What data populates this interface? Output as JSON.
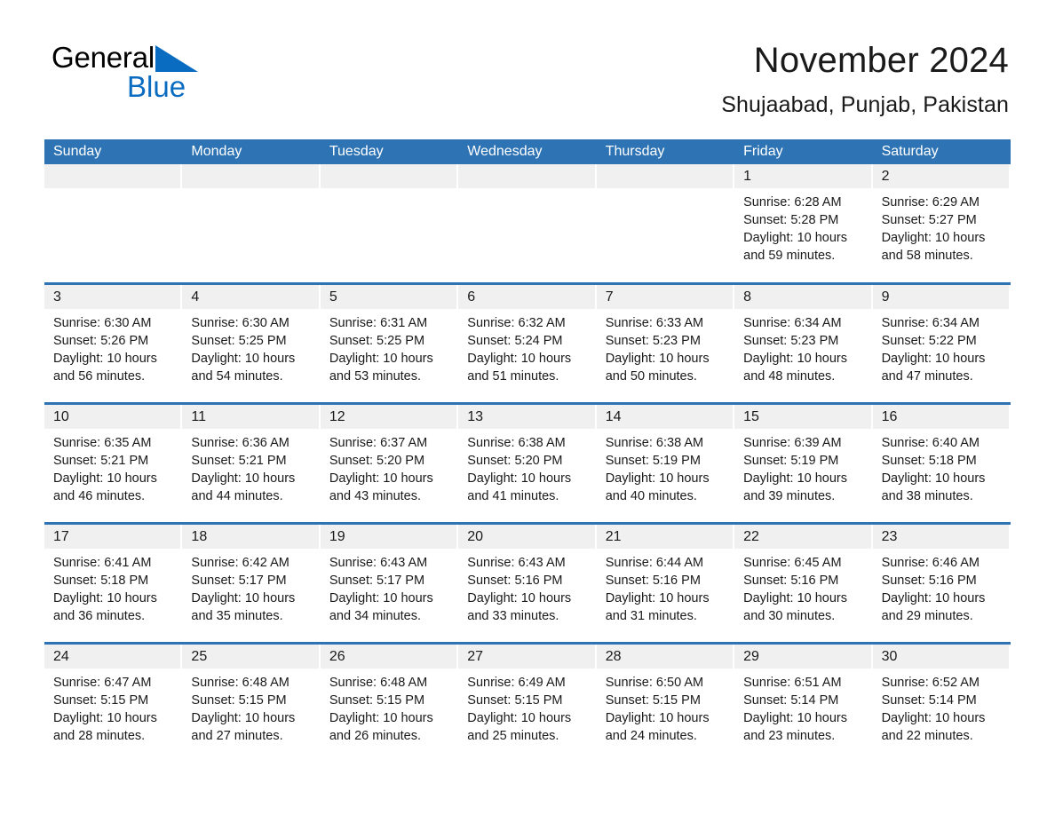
{
  "logo": {
    "word1": "General",
    "word2": "Blue",
    "triangle_color": "#0a6cc0",
    "icon": "triangle-icon"
  },
  "header": {
    "title": "November 2024",
    "subtitle": "Shujaabad, Punjab, Pakistan"
  },
  "colors": {
    "header_blue": "#2e74b5",
    "daynum_band": "#f0f0f0",
    "text": "#1a1a1a",
    "logo_blue": "#0a6cc0"
  },
  "weekdays": [
    "Sunday",
    "Monday",
    "Tuesday",
    "Wednesday",
    "Thursday",
    "Friday",
    "Saturday"
  ],
  "labels": {
    "sunrise_prefix": "Sunrise: ",
    "sunset_prefix": "Sunset: ",
    "daylight_prefix": "Daylight: "
  },
  "weeks": [
    [
      {
        "empty": true
      },
      {
        "empty": true
      },
      {
        "empty": true
      },
      {
        "empty": true
      },
      {
        "empty": true
      },
      {
        "day": "1",
        "sunrise": "Sunrise: 6:28 AM",
        "sunset": "Sunset: 5:28 PM",
        "daylight1": "Daylight: 10 hours",
        "daylight2": "and 59 minutes."
      },
      {
        "day": "2",
        "sunrise": "Sunrise: 6:29 AM",
        "sunset": "Sunset: 5:27 PM",
        "daylight1": "Daylight: 10 hours",
        "daylight2": "and 58 minutes."
      }
    ],
    [
      {
        "day": "3",
        "sunrise": "Sunrise: 6:30 AM",
        "sunset": "Sunset: 5:26 PM",
        "daylight1": "Daylight: 10 hours",
        "daylight2": "and 56 minutes."
      },
      {
        "day": "4",
        "sunrise": "Sunrise: 6:30 AM",
        "sunset": "Sunset: 5:25 PM",
        "daylight1": "Daylight: 10 hours",
        "daylight2": "and 54 minutes."
      },
      {
        "day": "5",
        "sunrise": "Sunrise: 6:31 AM",
        "sunset": "Sunset: 5:25 PM",
        "daylight1": "Daylight: 10 hours",
        "daylight2": "and 53 minutes."
      },
      {
        "day": "6",
        "sunrise": "Sunrise: 6:32 AM",
        "sunset": "Sunset: 5:24 PM",
        "daylight1": "Daylight: 10 hours",
        "daylight2": "and 51 minutes."
      },
      {
        "day": "7",
        "sunrise": "Sunrise: 6:33 AM",
        "sunset": "Sunset: 5:23 PM",
        "daylight1": "Daylight: 10 hours",
        "daylight2": "and 50 minutes."
      },
      {
        "day": "8",
        "sunrise": "Sunrise: 6:34 AM",
        "sunset": "Sunset: 5:23 PM",
        "daylight1": "Daylight: 10 hours",
        "daylight2": "and 48 minutes."
      },
      {
        "day": "9",
        "sunrise": "Sunrise: 6:34 AM",
        "sunset": "Sunset: 5:22 PM",
        "daylight1": "Daylight: 10 hours",
        "daylight2": "and 47 minutes."
      }
    ],
    [
      {
        "day": "10",
        "sunrise": "Sunrise: 6:35 AM",
        "sunset": "Sunset: 5:21 PM",
        "daylight1": "Daylight: 10 hours",
        "daylight2": "and 46 minutes."
      },
      {
        "day": "11",
        "sunrise": "Sunrise: 6:36 AM",
        "sunset": "Sunset: 5:21 PM",
        "daylight1": "Daylight: 10 hours",
        "daylight2": "and 44 minutes."
      },
      {
        "day": "12",
        "sunrise": "Sunrise: 6:37 AM",
        "sunset": "Sunset: 5:20 PM",
        "daylight1": "Daylight: 10 hours",
        "daylight2": "and 43 minutes."
      },
      {
        "day": "13",
        "sunrise": "Sunrise: 6:38 AM",
        "sunset": "Sunset: 5:20 PM",
        "daylight1": "Daylight: 10 hours",
        "daylight2": "and 41 minutes."
      },
      {
        "day": "14",
        "sunrise": "Sunrise: 6:38 AM",
        "sunset": "Sunset: 5:19 PM",
        "daylight1": "Daylight: 10 hours",
        "daylight2": "and 40 minutes."
      },
      {
        "day": "15",
        "sunrise": "Sunrise: 6:39 AM",
        "sunset": "Sunset: 5:19 PM",
        "daylight1": "Daylight: 10 hours",
        "daylight2": "and 39 minutes."
      },
      {
        "day": "16",
        "sunrise": "Sunrise: 6:40 AM",
        "sunset": "Sunset: 5:18 PM",
        "daylight1": "Daylight: 10 hours",
        "daylight2": "and 38 minutes."
      }
    ],
    [
      {
        "day": "17",
        "sunrise": "Sunrise: 6:41 AM",
        "sunset": "Sunset: 5:18 PM",
        "daylight1": "Daylight: 10 hours",
        "daylight2": "and 36 minutes."
      },
      {
        "day": "18",
        "sunrise": "Sunrise: 6:42 AM",
        "sunset": "Sunset: 5:17 PM",
        "daylight1": "Daylight: 10 hours",
        "daylight2": "and 35 minutes."
      },
      {
        "day": "19",
        "sunrise": "Sunrise: 6:43 AM",
        "sunset": "Sunset: 5:17 PM",
        "daylight1": "Daylight: 10 hours",
        "daylight2": "and 34 minutes."
      },
      {
        "day": "20",
        "sunrise": "Sunrise: 6:43 AM",
        "sunset": "Sunset: 5:16 PM",
        "daylight1": "Daylight: 10 hours",
        "daylight2": "and 33 minutes."
      },
      {
        "day": "21",
        "sunrise": "Sunrise: 6:44 AM",
        "sunset": "Sunset: 5:16 PM",
        "daylight1": "Daylight: 10 hours",
        "daylight2": "and 31 minutes."
      },
      {
        "day": "22",
        "sunrise": "Sunrise: 6:45 AM",
        "sunset": "Sunset: 5:16 PM",
        "daylight1": "Daylight: 10 hours",
        "daylight2": "and 30 minutes."
      },
      {
        "day": "23",
        "sunrise": "Sunrise: 6:46 AM",
        "sunset": "Sunset: 5:16 PM",
        "daylight1": "Daylight: 10 hours",
        "daylight2": "and 29 minutes."
      }
    ],
    [
      {
        "day": "24",
        "sunrise": "Sunrise: 6:47 AM",
        "sunset": "Sunset: 5:15 PM",
        "daylight1": "Daylight: 10 hours",
        "daylight2": "and 28 minutes."
      },
      {
        "day": "25",
        "sunrise": "Sunrise: 6:48 AM",
        "sunset": "Sunset: 5:15 PM",
        "daylight1": "Daylight: 10 hours",
        "daylight2": "and 27 minutes."
      },
      {
        "day": "26",
        "sunrise": "Sunrise: 6:48 AM",
        "sunset": "Sunset: 5:15 PM",
        "daylight1": "Daylight: 10 hours",
        "daylight2": "and 26 minutes."
      },
      {
        "day": "27",
        "sunrise": "Sunrise: 6:49 AM",
        "sunset": "Sunset: 5:15 PM",
        "daylight1": "Daylight: 10 hours",
        "daylight2": "and 25 minutes."
      },
      {
        "day": "28",
        "sunrise": "Sunrise: 6:50 AM",
        "sunset": "Sunset: 5:15 PM",
        "daylight1": "Daylight: 10 hours",
        "daylight2": "and 24 minutes."
      },
      {
        "day": "29",
        "sunrise": "Sunrise: 6:51 AM",
        "sunset": "Sunset: 5:14 PM",
        "daylight1": "Daylight: 10 hours",
        "daylight2": "and 23 minutes."
      },
      {
        "day": "30",
        "sunrise": "Sunrise: 6:52 AM",
        "sunset": "Sunset: 5:14 PM",
        "daylight1": "Daylight: 10 hours",
        "daylight2": "and 22 minutes."
      }
    ]
  ]
}
